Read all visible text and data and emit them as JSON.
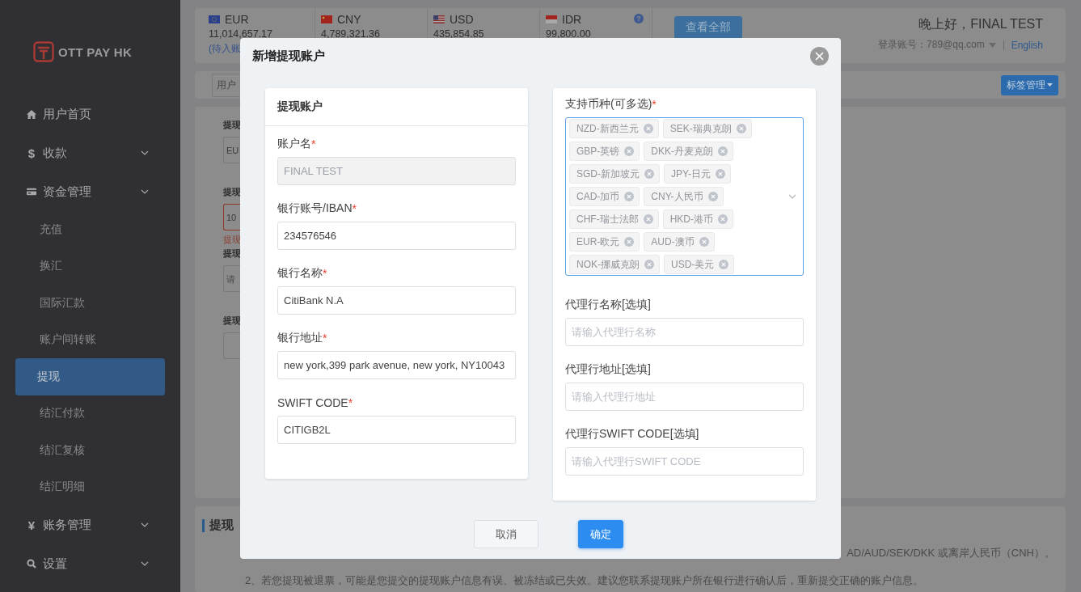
{
  "sidebar": {
    "logo": "OTT PAY HK",
    "items": [
      {
        "label": "用户首页",
        "icon": {
          "kind": "home"
        },
        "submenu": false
      },
      {
        "label": "收款",
        "icon": {
          "kind": "glyph",
          "text": "$"
        },
        "submenu": true
      },
      {
        "label": "资金管理",
        "icon": {
          "kind": "card"
        },
        "submenu": true,
        "children": [
          {
            "label": "充值",
            "selected": false
          },
          {
            "label": "换汇",
            "selected": false
          },
          {
            "label": "国际汇款",
            "selected": false
          },
          {
            "label": "账户间转账",
            "selected": false
          },
          {
            "label": "提现",
            "selected": true
          },
          {
            "label": "结汇付款",
            "selected": false
          },
          {
            "label": "结汇复核",
            "selected": false
          },
          {
            "label": "结汇明细",
            "selected": false
          }
        ]
      },
      {
        "label": "账务管理",
        "icon": {
          "kind": "glyph",
          "text": "¥"
        },
        "submenu": true
      },
      {
        "label": "设置",
        "icon": {
          "kind": "search"
        },
        "submenu": true
      }
    ]
  },
  "balances": [
    {
      "code": "EUR",
      "flag": {
        "kind": "eu"
      },
      "amount": "11,014,657.17",
      "note": "(待入账"
    },
    {
      "code": "CNY",
      "flag": {
        "kind": "cn"
      },
      "amount": "4,789,321.36"
    },
    {
      "code": "USD",
      "flag": {
        "kind": "us"
      },
      "amount": "435,854.85"
    },
    {
      "code": "IDR",
      "flag": {
        "kind": "id"
      },
      "amount": "99,800.00",
      "help": "?"
    }
  ],
  "view_all_button": "查看全部",
  "user": {
    "greeting": "晚上好，FINAL TEST",
    "account_label": "登录账号：789@qq.com",
    "language": "English"
  },
  "breadcrumb": "用户",
  "tag_manage_button": "标签管理",
  "background_form": [
    {
      "label": "提现",
      "value": "EU",
      "error": false
    },
    {
      "label": "提现",
      "value": "10",
      "error": true,
      "message": "提现"
    },
    {
      "label": "提现",
      "placeholder": "请",
      "error": false
    },
    {
      "label": "提现",
      "error": false
    }
  ],
  "notes": {
    "title": "提现",
    "lines": [
      "AD/AUD/SEK/DKK 或离岸人民币（CNH）。",
      "2、若您提现被退票，可能是您提交的提现账户信息有误、被冻结或已失效。建议您联系提现账户所在银行进行确认后，重新提交正确的账户信息。"
    ]
  },
  "dialog": {
    "title": "新增提现账户",
    "account_card": {
      "title": "提现账户",
      "fields": [
        {
          "label": "账户名",
          "required_mark": "*",
          "value": "FINAL TEST",
          "disabled": true
        },
        {
          "label": "银行账号/IBAN",
          "required_mark": "*",
          "value": "234576546",
          "disabled": false
        },
        {
          "label": "银行名称",
          "required_mark": "*",
          "value": "CitiBank N.A",
          "disabled": false
        },
        {
          "label": "银行地址",
          "required_mark": "*",
          "value": "new york,399 park avenue, new york, NY10043",
          "disabled": false
        },
        {
          "label": "SWIFT CODE",
          "required_mark": "*",
          "value": "CITIGB2L",
          "disabled": false
        }
      ]
    },
    "currencies": {
      "label": "支持币种(可多选)",
      "required_mark": "*",
      "tags": [
        "NZD-新西兰元",
        "SEK-瑞典克朗",
        "GBP-英镑",
        "DKK-丹麦克朗",
        "SGD-新加坡元",
        "JPY-日元",
        "CAD-加币",
        "CNY-人民币",
        "CHF-瑞士法郎",
        "HKD-港币",
        "EUR-欧元",
        "AUD-澳币",
        "NOK-挪威克朗",
        "USD-美元"
      ]
    },
    "optional_fields": [
      {
        "label": "代理行名称[选填]",
        "placeholder": "请输入代理行名称"
      },
      {
        "label": "代理行地址[选填]",
        "placeholder": "请输入代理行地址"
      },
      {
        "label": "代理行SWIFT CODE[选填]",
        "placeholder": "请输入代理行SWIFT CODE"
      }
    ],
    "buttons": [
      {
        "label": "取消",
        "kind": "secondary"
      },
      {
        "label": "确定",
        "kind": "primary"
      }
    ]
  }
}
